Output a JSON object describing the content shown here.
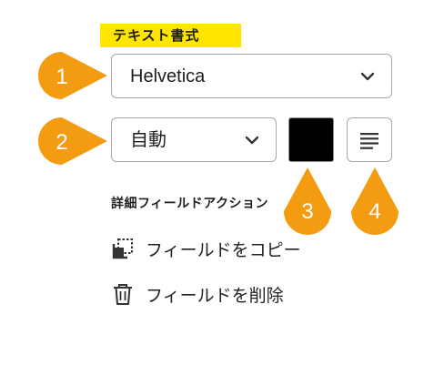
{
  "section": {
    "title": "テキスト書式"
  },
  "font_select": {
    "value": "Helvetica"
  },
  "size_select": {
    "value": "自動"
  },
  "color": {
    "swatch": "#000000"
  },
  "details": {
    "label": "詳細フィールドアクション"
  },
  "actions": [
    {
      "label": "フィールドをコピー",
      "icon": "copy-field-icon"
    },
    {
      "label": "フィールドを削除",
      "icon": "trash-icon"
    }
  ],
  "callouts": [
    {
      "number": "1"
    },
    {
      "number": "2"
    },
    {
      "number": "3"
    },
    {
      "number": "4"
    }
  ],
  "colors": {
    "highlight": "#ffe600",
    "callout": "#f39c12",
    "border": "#a8a8a8"
  }
}
